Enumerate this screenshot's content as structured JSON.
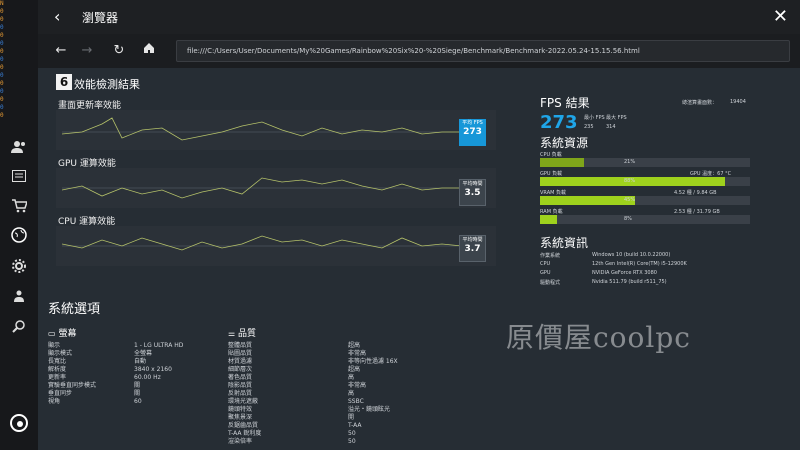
{
  "overlay": {
    "lines": [
      "N",
      "0",
      "0",
      "0",
      "0",
      "0",
      "0",
      "0",
      "0",
      "0",
      "0",
      "0",
      "0",
      "0",
      "0"
    ]
  },
  "browser": {
    "title": "瀏覽器",
    "url": "file:///C:/Users/User/Documents/My%20Games/Rainbow%20Six%20-%20Siege/Benchmark/Benchmark-2022.05.24-15.15.56.html"
  },
  "page": {
    "logo_small": "6",
    "title": "效能檢測結果",
    "sections": {
      "refresh": {
        "title": "畫面更新率效能",
        "badge_label": "平均 FPS",
        "badge_value": "273"
      },
      "gpu": {
        "title": "GPU 運算效能",
        "badge_label": "平均時間",
        "badge_value": "3.5"
      },
      "cpu": {
        "title": "CPU 運算效能",
        "badge_label": "平均時間",
        "badge_value": "3.7"
      }
    },
    "fps_result": {
      "title": "FPS 結果",
      "total_frames_label": "總渲算畫面數：",
      "total_frames": "19404",
      "value": "273",
      "min_label": "最小 FPS",
      "max_label": "最大 FPS",
      "min_value": "235",
      "max_value": "314"
    },
    "resources": {
      "title": "系統資源",
      "rows": [
        {
          "label": "CPU 負載",
          "pct": "21%"
        },
        {
          "label": "GPU 負載",
          "pct": "88%",
          "right": "GPU 溫度：67 °C"
        },
        {
          "label": "VRAM 負載",
          "pct": "45%",
          "right": "4.52 種 / 9.84 GB"
        },
        {
          "label": "RAM 負載",
          "pct": "8%",
          "right": "2.53 種 / 31.79 GB"
        }
      ]
    },
    "sysinfo": {
      "title": "系統資訊",
      "rows": [
        {
          "k": "作業系統",
          "v": "Windows 10 (build 10.0.22000)"
        },
        {
          "k": "CPU",
          "v": "12th Gen Intel(R) Core(TM) i5-12900K"
        },
        {
          "k": "GPU",
          "v": "NVIDIA GeForce RTX 3080"
        },
        {
          "k": "驅動程式",
          "v": "Nvidia 511.79 (build r511_75)"
        }
      ]
    },
    "options": {
      "title": "系統選項",
      "display": {
        "title": "螢幕",
        "rows": [
          {
            "k": "顯示",
            "v": "1 - LG ULTRA HD"
          },
          {
            "k": "顯示模式",
            "v": "全螢幕"
          },
          {
            "k": "長寬比",
            "v": "自動"
          },
          {
            "k": "解析度",
            "v": "3840 x 2160"
          },
          {
            "k": "更新率",
            "v": "60.00 Hz"
          },
          {
            "k": "實驗垂直同步模式",
            "v": "關"
          },
          {
            "k": "垂直同步",
            "v": "關"
          },
          {
            "k": "視角",
            "v": "60"
          }
        ]
      },
      "quality": {
        "title": "品質",
        "rows": [
          {
            "k": "整體品質",
            "v": "超高"
          },
          {
            "k": "貼圖品質",
            "v": "非常高"
          },
          {
            "k": "材質過濾",
            "v": "非等向性過濾 16X"
          },
          {
            "k": "細節層次",
            "v": "超高"
          },
          {
            "k": "著色品質",
            "v": "高"
          },
          {
            "k": "陰影品質",
            "v": "非常高"
          },
          {
            "k": "反射品質",
            "v": "高"
          },
          {
            "k": "環境光遮蔽",
            "v": "SSBC"
          },
          {
            "k": "鏡頭特效",
            "v": "溢光・鏡頭眩光"
          },
          {
            "k": "聚焦景深",
            "v": "開"
          },
          {
            "k": "反鋸齒品質",
            "v": "T-AA"
          },
          {
            "k": "T-AA 銳利度",
            "v": "50"
          },
          {
            "k": "渲染倍率",
            "v": "50"
          }
        ]
      }
    },
    "watermark": "原價屋coolpc"
  }
}
